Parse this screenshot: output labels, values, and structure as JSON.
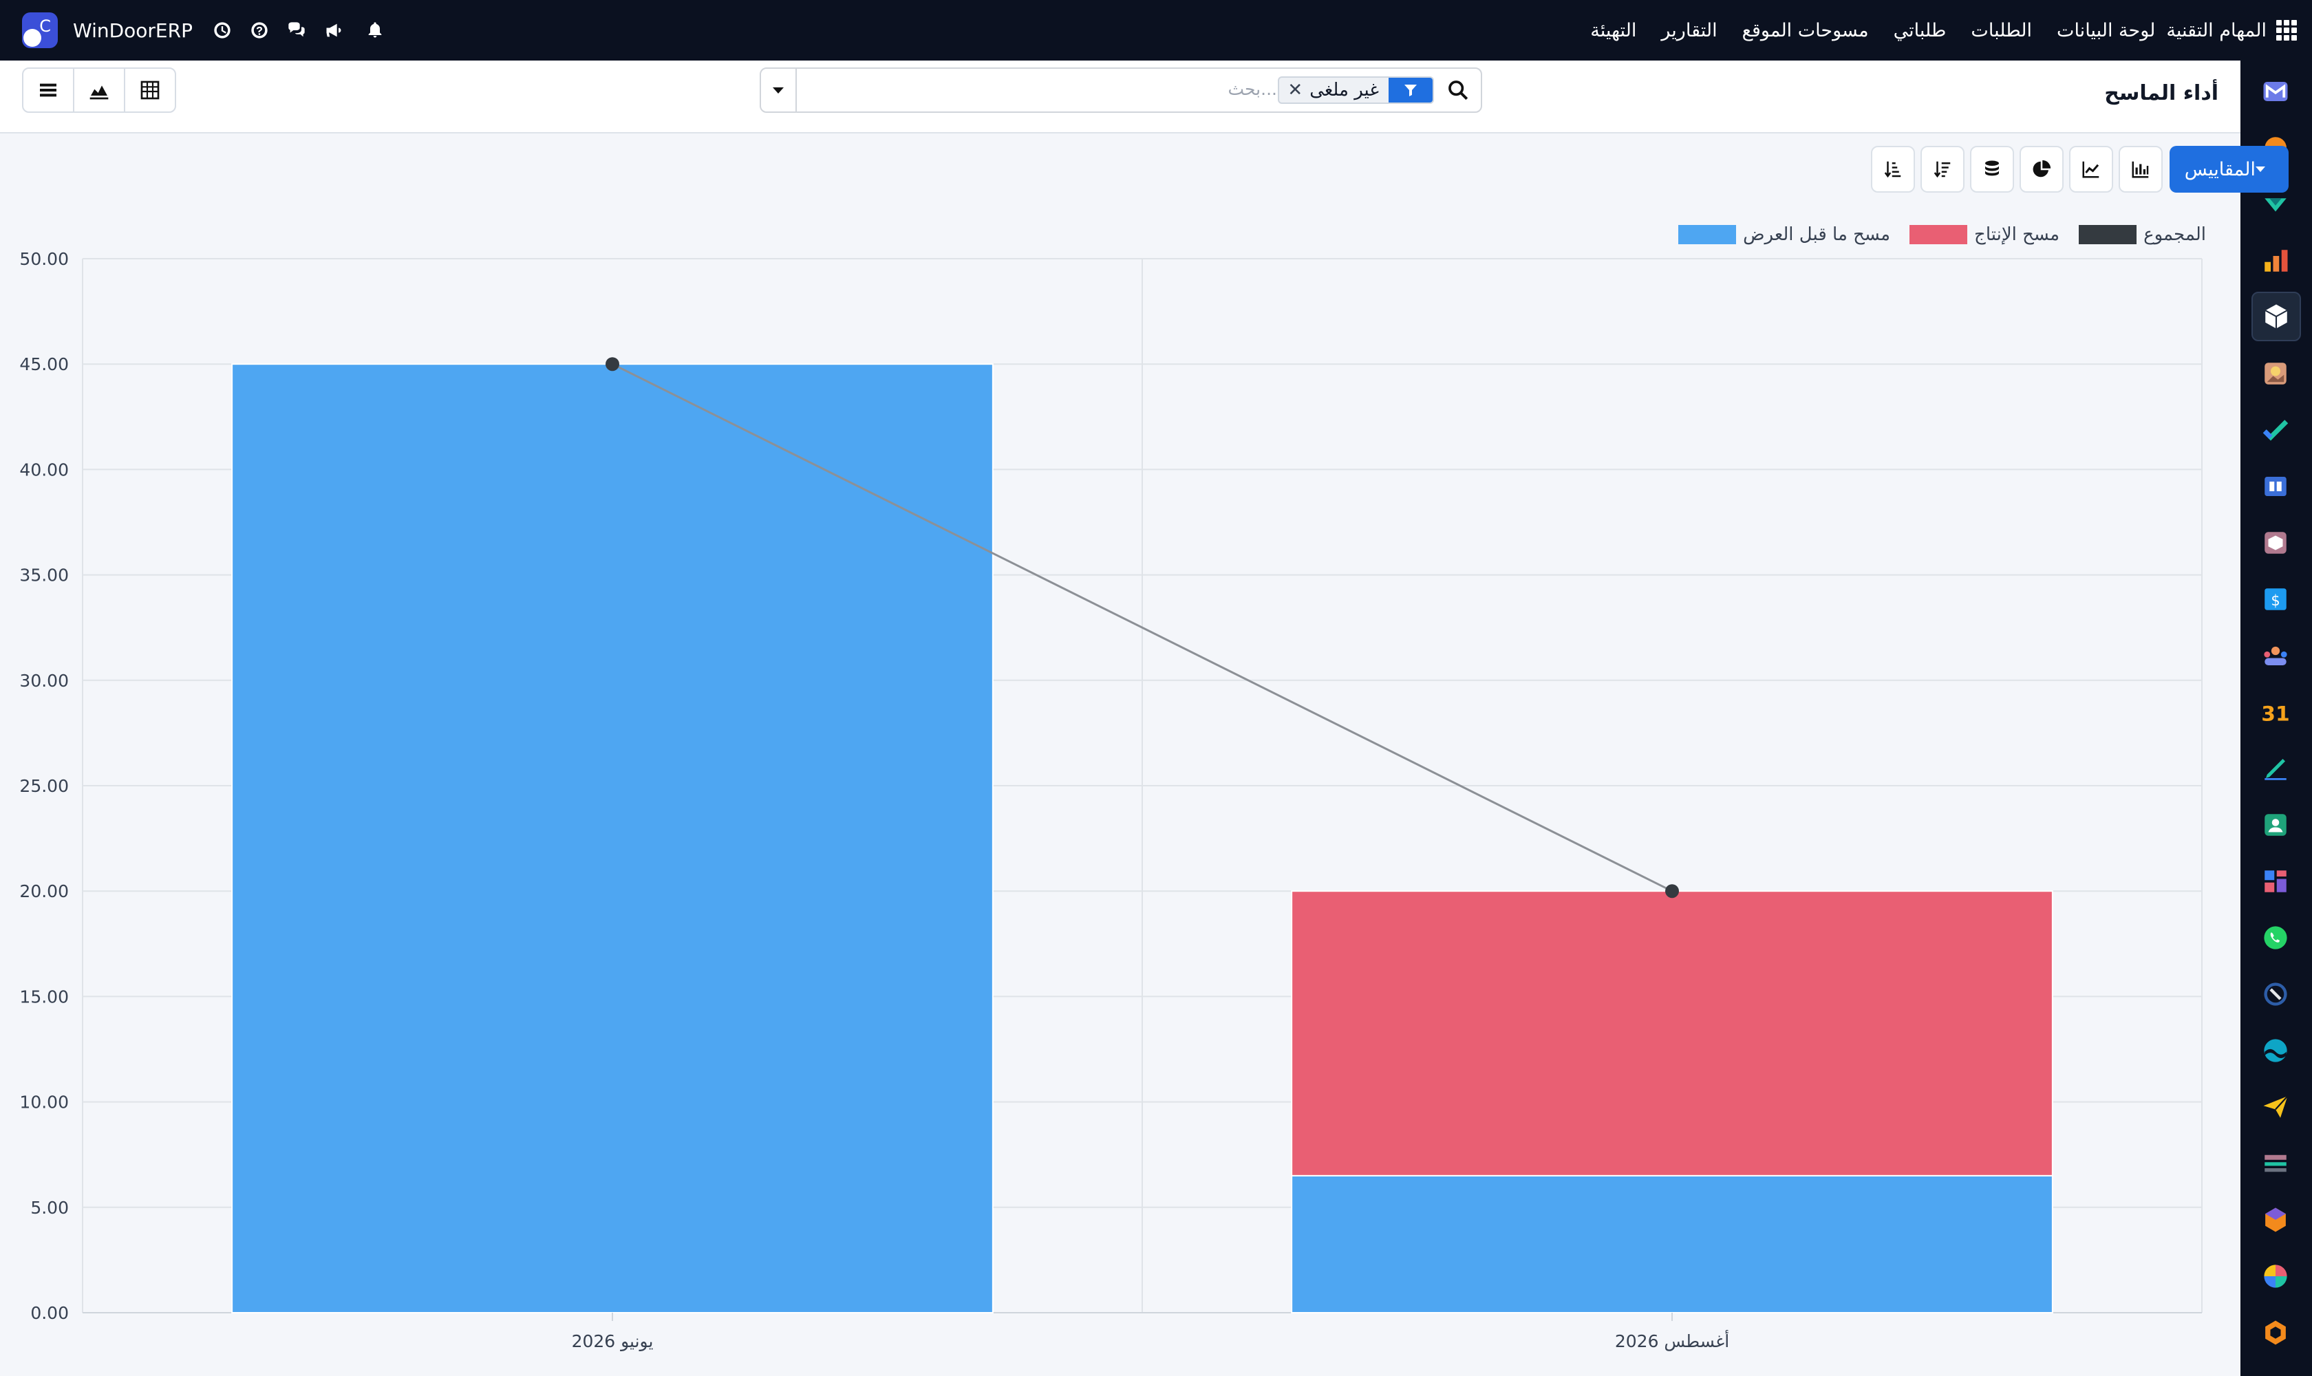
{
  "app": {
    "brand": "WinDoorERP",
    "menu": [
      "المهام التقنية",
      "لوحة البيانات",
      "الطلبات",
      "طلباتي",
      "مسوحات الموقع",
      "التقارير",
      "التهيئة"
    ]
  },
  "control_panel": {
    "title": "أداء الماسح",
    "search": {
      "placeholder": "بحث...",
      "facet_label": "غير ملغى"
    }
  },
  "toolbar": {
    "measures_label": "المقاييس"
  },
  "sidebar_icons": [
    "gmail-icon",
    "chat-bubble-icon",
    "vcheck-icon",
    "bar-chart-icon",
    "cube-icon",
    "photo-icon",
    "checkmark-icon",
    "book-icon",
    "box-icon",
    "invoice-icon",
    "team-icon",
    "calendar-31-icon",
    "pen-icon",
    "contact-icon",
    "grid-icon",
    "whatsapp-icon",
    "compass-icon",
    "wave-icon",
    "paper-plane-icon",
    "card-icon",
    "hexagon-icon",
    "pie-icon",
    "hexagon-orange-icon"
  ],
  "colors": {
    "primary": "#1f6fe0",
    "navbar": "#0b1120",
    "series_preview": "#4ea6f2",
    "series_production": "#e95f73",
    "series_total": "#343a40"
  },
  "chart_data": {
    "type": "bar",
    "stacked": true,
    "categories": [
      "يونيو 2026",
      "أغسطس 2026"
    ],
    "series": [
      {
        "name": "مسح ما قبل العرض",
        "values": [
          45.0,
          6.5
        ],
        "color": "#4ea6f2"
      },
      {
        "name": "مسح الإنتاج",
        "values": [
          0.0,
          13.5
        ],
        "color": "#e95f73"
      },
      {
        "name": "المجموع",
        "type": "line",
        "values": [
          45.0,
          20.0
        ],
        "color": "#343a40"
      }
    ],
    "ylim": [
      0,
      50
    ],
    "yticks": [
      "0.00",
      "5.00",
      "10.00",
      "15.00",
      "20.00",
      "25.00",
      "30.00",
      "35.00",
      "40.00",
      "45.00",
      "50.00"
    ],
    "grid": true,
    "legend_position": "top-right"
  }
}
